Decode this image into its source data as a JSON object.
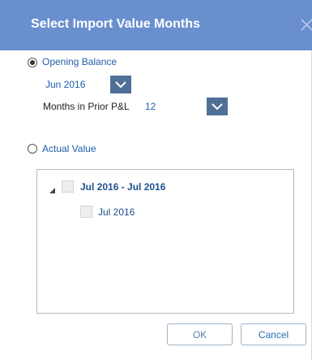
{
  "dialog": {
    "title": "Select Import Value Months",
    "close_icon": "close-icon"
  },
  "opening_balance": {
    "label": "Opening Balance",
    "checked": true,
    "month_select": {
      "value": "Jun 2016"
    },
    "months_in_prior_label": "Months in Prior P&L",
    "months_in_prior_select": {
      "value": "12"
    }
  },
  "actual_value": {
    "label": "Actual Value",
    "checked": false
  },
  "tree": {
    "parent": {
      "label": "Jul 2016 - Jul 2016",
      "expanded": true,
      "checked": false
    },
    "children": [
      {
        "label": "Jul 2016",
        "checked": false
      }
    ]
  },
  "buttons": {
    "ok_label": "OK",
    "cancel_label": "Cancel"
  },
  "colors": {
    "title_bar": "#6a8fcf",
    "dropdown_arrow": "#4f6f96",
    "link_text": "#1f5fa8"
  }
}
